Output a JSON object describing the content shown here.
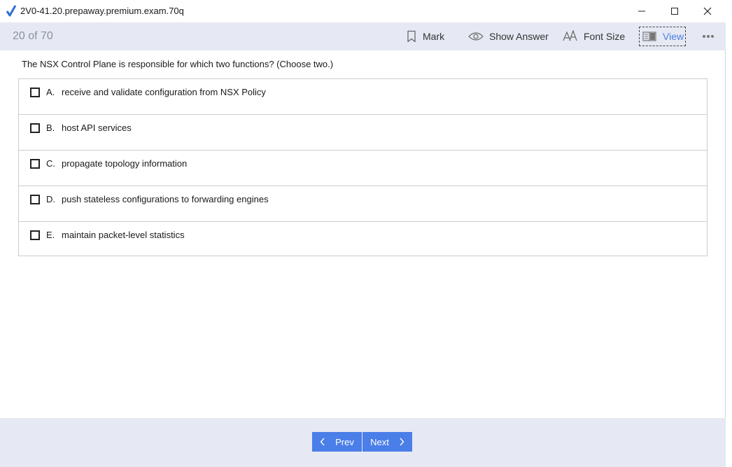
{
  "window": {
    "title": "2V0-41.20.prepaway.premium.exam.70q",
    "controls": [
      "minimize-icon",
      "maximize-icon",
      "close-icon"
    ]
  },
  "toolbar": {
    "counter": "20 of 70",
    "mark_label": "Mark",
    "show_answer_label": "Show Answer",
    "font_size_label": "Font Size",
    "view_label": "View",
    "more_icon": "more-icon"
  },
  "question": {
    "text": "The NSX Control Plane is responsible for which two functions? (Choose two.)",
    "options": [
      {
        "letter": "A.",
        "text": "receive and validate configuration from NSX Policy",
        "checked": false
      },
      {
        "letter": "B.",
        "text": "host API services",
        "checked": false
      },
      {
        "letter": "C.",
        "text": "propagate topology information",
        "checked": false
      },
      {
        "letter": "D.",
        "text": "push stateless configurations to forwarding engines",
        "checked": false
      },
      {
        "letter": "E.",
        "text": "maintain packet-level statistics",
        "checked": false
      }
    ]
  },
  "footer": {
    "prev_label": "Prev",
    "next_label": "Next"
  },
  "colors": {
    "accent": "#4a7ee8",
    "toolbar_bg": "#e6e9f3",
    "view_text": "#4a7ee0"
  }
}
